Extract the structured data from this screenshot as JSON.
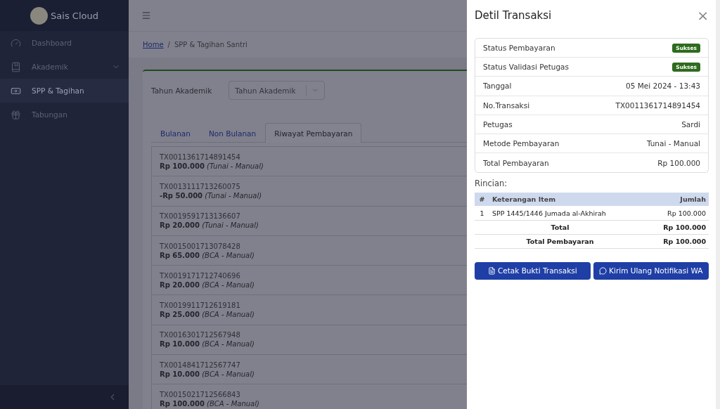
{
  "sidebar": {
    "brand": "Sais Cloud",
    "items": [
      {
        "label": "Dashboard",
        "selected": false,
        "expandable": false
      },
      {
        "label": "Akademik",
        "selected": false,
        "expandable": true
      },
      {
        "label": "SPP & Tagihan",
        "selected": true,
        "expandable": false
      },
      {
        "label": "Tabungan",
        "selected": false,
        "expandable": false
      }
    ]
  },
  "breadcrumb": {
    "separator": "/",
    "items": [
      {
        "label": "Home",
        "link": true
      },
      {
        "label": "SPP & Tagihan Santri",
        "link": false
      }
    ]
  },
  "filter": {
    "label": "Tahun Akademik",
    "placeholder": "Tahun Akademik"
  },
  "tabs": [
    {
      "label": "Bulanan",
      "selected": false
    },
    {
      "label": "Non Bulanan",
      "selected": false
    },
    {
      "label": "Riwayat Pembayaran",
      "selected": true
    }
  ],
  "transactions": [
    {
      "id": "TX0011361714891454",
      "amount": "Rp 100.000",
      "method": "(Tunai - Manual)"
    },
    {
      "id": "TX0013111713260075",
      "amount": "-Rp 50.000",
      "method": "(Tunai - Manual)"
    },
    {
      "id": "TX0019591713136607",
      "amount": "Rp 20.000",
      "method": "(Tunai - Manual)"
    },
    {
      "id": "TX0015001713078428",
      "amount": "Rp 65.000",
      "method": "(BCA - Manual)"
    },
    {
      "id": "TX0019171712740696",
      "amount": "Rp 20.000",
      "method": "(BCA - Manual)"
    },
    {
      "id": "TX0019911712619181",
      "amount": "Rp 25.000",
      "method": "(BCA - Manual)"
    },
    {
      "id": "TX0016301712567948",
      "amount": "Rp 10.000",
      "method": "(BCA - Manual)"
    },
    {
      "id": "TX0014841712567747",
      "amount": "Rp 10.000",
      "method": "(BCA - Manual)"
    },
    {
      "id": "TX0015021712566843",
      "amount": "Rp 100.000",
      "method": "(BCA - Manual)"
    }
  ],
  "drawer": {
    "title": "Detil Transaksi",
    "close": "×",
    "details": [
      {
        "label": "Status Pembayaran",
        "value": "Sukses",
        "kind": "badge"
      },
      {
        "label": "Status Validasi Petugas",
        "value": "Sukses",
        "kind": "badge"
      },
      {
        "label": "Tanggal",
        "value": "05 Mei 2024 - 13:43",
        "kind": "text"
      },
      {
        "label": "No.Transaksi",
        "value": "TX0011361714891454",
        "kind": "text"
      },
      {
        "label": "Petugas",
        "value": "Sardi",
        "kind": "text"
      },
      {
        "label": "Metode Pembayaran",
        "value": "Tunai - Manual",
        "kind": "text"
      },
      {
        "label": "Total Pembayaran",
        "value": "Rp 100.000",
        "kind": "text"
      }
    ],
    "rincian_title": "Rincian:",
    "table": {
      "columns": [
        "#",
        "Keterangan Item",
        "Jumlah"
      ],
      "rows": [
        {
          "no": "1",
          "item": "SPP 1445/1446 Jumada al-Akhirah",
          "amount": "Rp 100.000"
        }
      ],
      "totals": [
        {
          "label": "Total",
          "amount": "Rp 100.000"
        },
        {
          "label": "Total Pembayaran",
          "amount": "Rp 100.000"
        }
      ]
    },
    "buttons": [
      {
        "label": "Cetak Bukti Transaksi"
      },
      {
        "label": "Kirim Ulang Notifikasi WA"
      }
    ]
  }
}
